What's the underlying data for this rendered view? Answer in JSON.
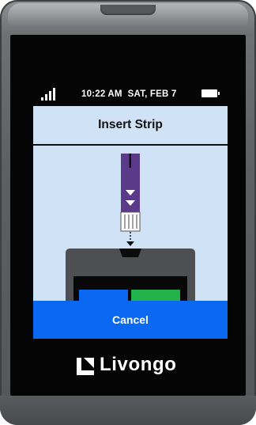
{
  "status_bar": {
    "time": "10:22 AM",
    "date": "SAT, FEB 7",
    "signal_icon": "signal-bars-icon",
    "battery_icon": "battery-icon"
  },
  "screen": {
    "title": "Insert Strip",
    "illustration": "insert-strip-into-meter"
  },
  "buttons": {
    "cancel_label": "Cancel"
  },
  "brand": {
    "name": "Livongo",
    "logo_icon": "livongo-logo-icon"
  },
  "colors": {
    "screen_background": "#cfe2f6",
    "cancel_button": "#0a68f1",
    "strip_purple": "#5b3a8a",
    "meter_blue": "#0a68f1",
    "meter_green": "#22b24c"
  }
}
